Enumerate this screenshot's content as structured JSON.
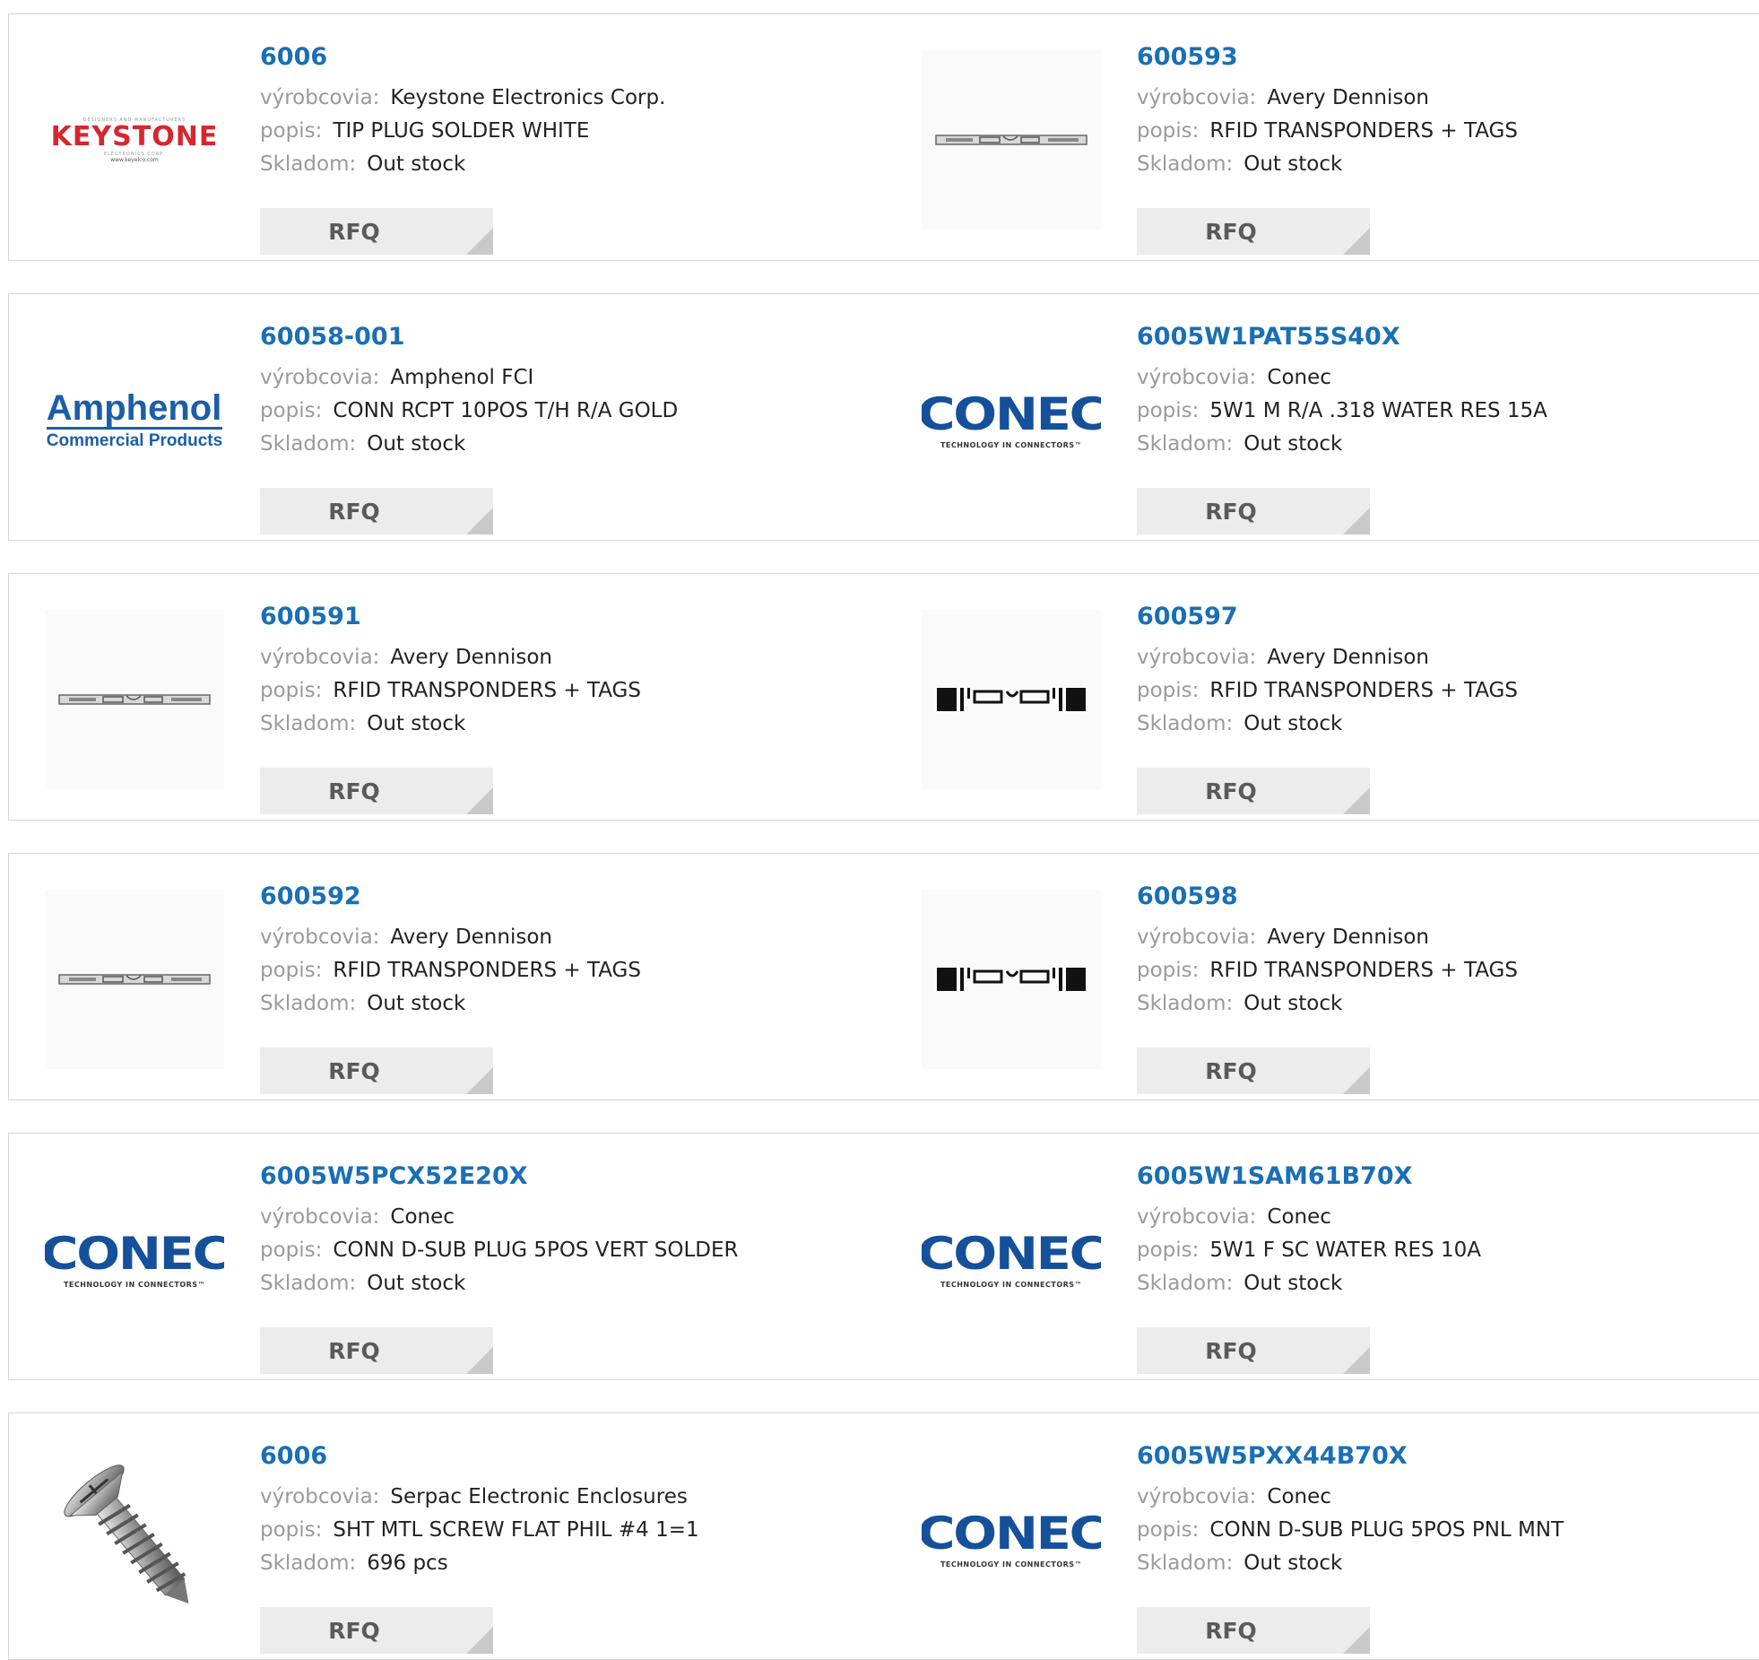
{
  "labels": {
    "manufacturer": "výrobcovia:",
    "description": "popis:",
    "stock": "Skladom:",
    "rfq": "RFQ"
  },
  "products": [
    {
      "part": "6006",
      "manufacturer": "Keystone Electronics Corp.",
      "description": "TIP PLUG SOLDER WHITE",
      "stock": "Out stock",
      "logo": "keystone",
      "logo_text": {
        "tagline": "DESIGNERS AND MANUFACTURERS",
        "name": "KEYSTONE",
        "sub": "ELECTRONICS CORP.",
        "web": "www.keyelco.com"
      }
    },
    {
      "part": "600593",
      "manufacturer": "Avery Dennison",
      "description": "RFID TRANSPONDERS + TAGS",
      "stock": "Out stock",
      "logo": "rfid-strip"
    },
    {
      "part": "60058-001",
      "manufacturer": "Amphenol FCI",
      "description": "CONN RCPT 10POS T/H R/A GOLD",
      "stock": "Out stock",
      "logo": "amphenol",
      "logo_text": {
        "name": "Amphenol",
        "sub": "Commercial Products"
      }
    },
    {
      "part": "6005W1PAT55S40X",
      "manufacturer": "Conec",
      "description": "5W1 M R/A .318 WATER RES 15A",
      "stock": "Out stock",
      "logo": "conec",
      "logo_text": {
        "name": "CONEC",
        "sub": "TECHNOLOGY IN CONNECTORS™"
      }
    },
    {
      "part": "600591",
      "manufacturer": "Avery Dennison",
      "description": "RFID TRANSPONDERS + TAGS",
      "stock": "Out stock",
      "logo": "rfid-strip"
    },
    {
      "part": "600597",
      "manufacturer": "Avery Dennison",
      "description": "RFID TRANSPONDERS + TAGS",
      "stock": "Out stock",
      "logo": "rfid-dipole"
    },
    {
      "part": "600592",
      "manufacturer": "Avery Dennison",
      "description": "RFID TRANSPONDERS + TAGS",
      "stock": "Out stock",
      "logo": "rfid-strip"
    },
    {
      "part": "600598",
      "manufacturer": "Avery Dennison",
      "description": "RFID TRANSPONDERS + TAGS",
      "stock": "Out stock",
      "logo": "rfid-dipole"
    },
    {
      "part": "6005W5PCX52E20X",
      "manufacturer": "Conec",
      "description": "CONN D-SUB PLUG 5POS VERT SOLDER",
      "stock": "Out stock",
      "logo": "conec",
      "logo_text": {
        "name": "CONEC",
        "sub": "TECHNOLOGY IN CONNECTORS™"
      }
    },
    {
      "part": "6005W1SAM61B70X",
      "manufacturer": "Conec",
      "description": "5W1 F SC WATER RES 10A",
      "stock": "Out stock",
      "logo": "conec",
      "logo_text": {
        "name": "CONEC",
        "sub": "TECHNOLOGY IN CONNECTORS™"
      }
    },
    {
      "part": "6006",
      "manufacturer": "Serpac Electronic Enclosures",
      "description": "SHT MTL SCREW FLAT PHIL #4 1=1",
      "stock": "696 pcs",
      "logo": "screw-photo"
    },
    {
      "part": "6005W5PXX44B70X",
      "manufacturer": "Conec",
      "description": "CONN D-SUB PLUG 5POS PNL MNT",
      "stock": "Out stock",
      "logo": "conec",
      "logo_text": {
        "name": "CONEC",
        "sub": "TECHNOLOGY IN CONNECTORS™"
      }
    }
  ],
  "colors": {
    "part_link": "#1a6fb5",
    "label": "#9a9a9a",
    "rfq_bg": "#ececec",
    "keystone_red": "#d6262f",
    "conec_blue": "#15509a"
  }
}
